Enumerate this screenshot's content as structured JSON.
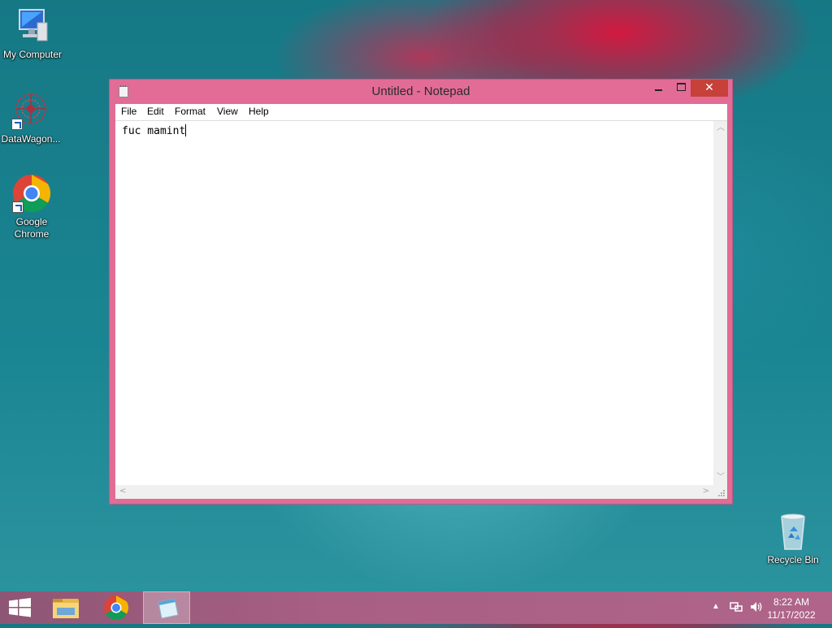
{
  "desktop": {
    "icons": [
      {
        "label": "My Computer"
      },
      {
        "label": "DataWagon..."
      },
      {
        "label": "Google Chrome"
      },
      {
        "label": "Recycle Bin"
      }
    ]
  },
  "window": {
    "title": "Untitled - Notepad",
    "controls": {
      "minimize": "minimize",
      "maximize": "maximize",
      "close": "✕"
    },
    "menu": [
      "File",
      "Edit",
      "Format",
      "View",
      "Help"
    ],
    "editor_text": "fuc mamint"
  },
  "taskbar": {
    "pinned": [
      "start-icon",
      "file-explorer-icon",
      "chrome-icon",
      "notepad-icon"
    ],
    "clock": {
      "time": "8:22 AM",
      "date": "11/17/2022"
    }
  },
  "colors": {
    "window_frame": "#e26c96",
    "close_button": "#c7413a",
    "desktop": "#167885",
    "taskbar": "#a85f83"
  }
}
